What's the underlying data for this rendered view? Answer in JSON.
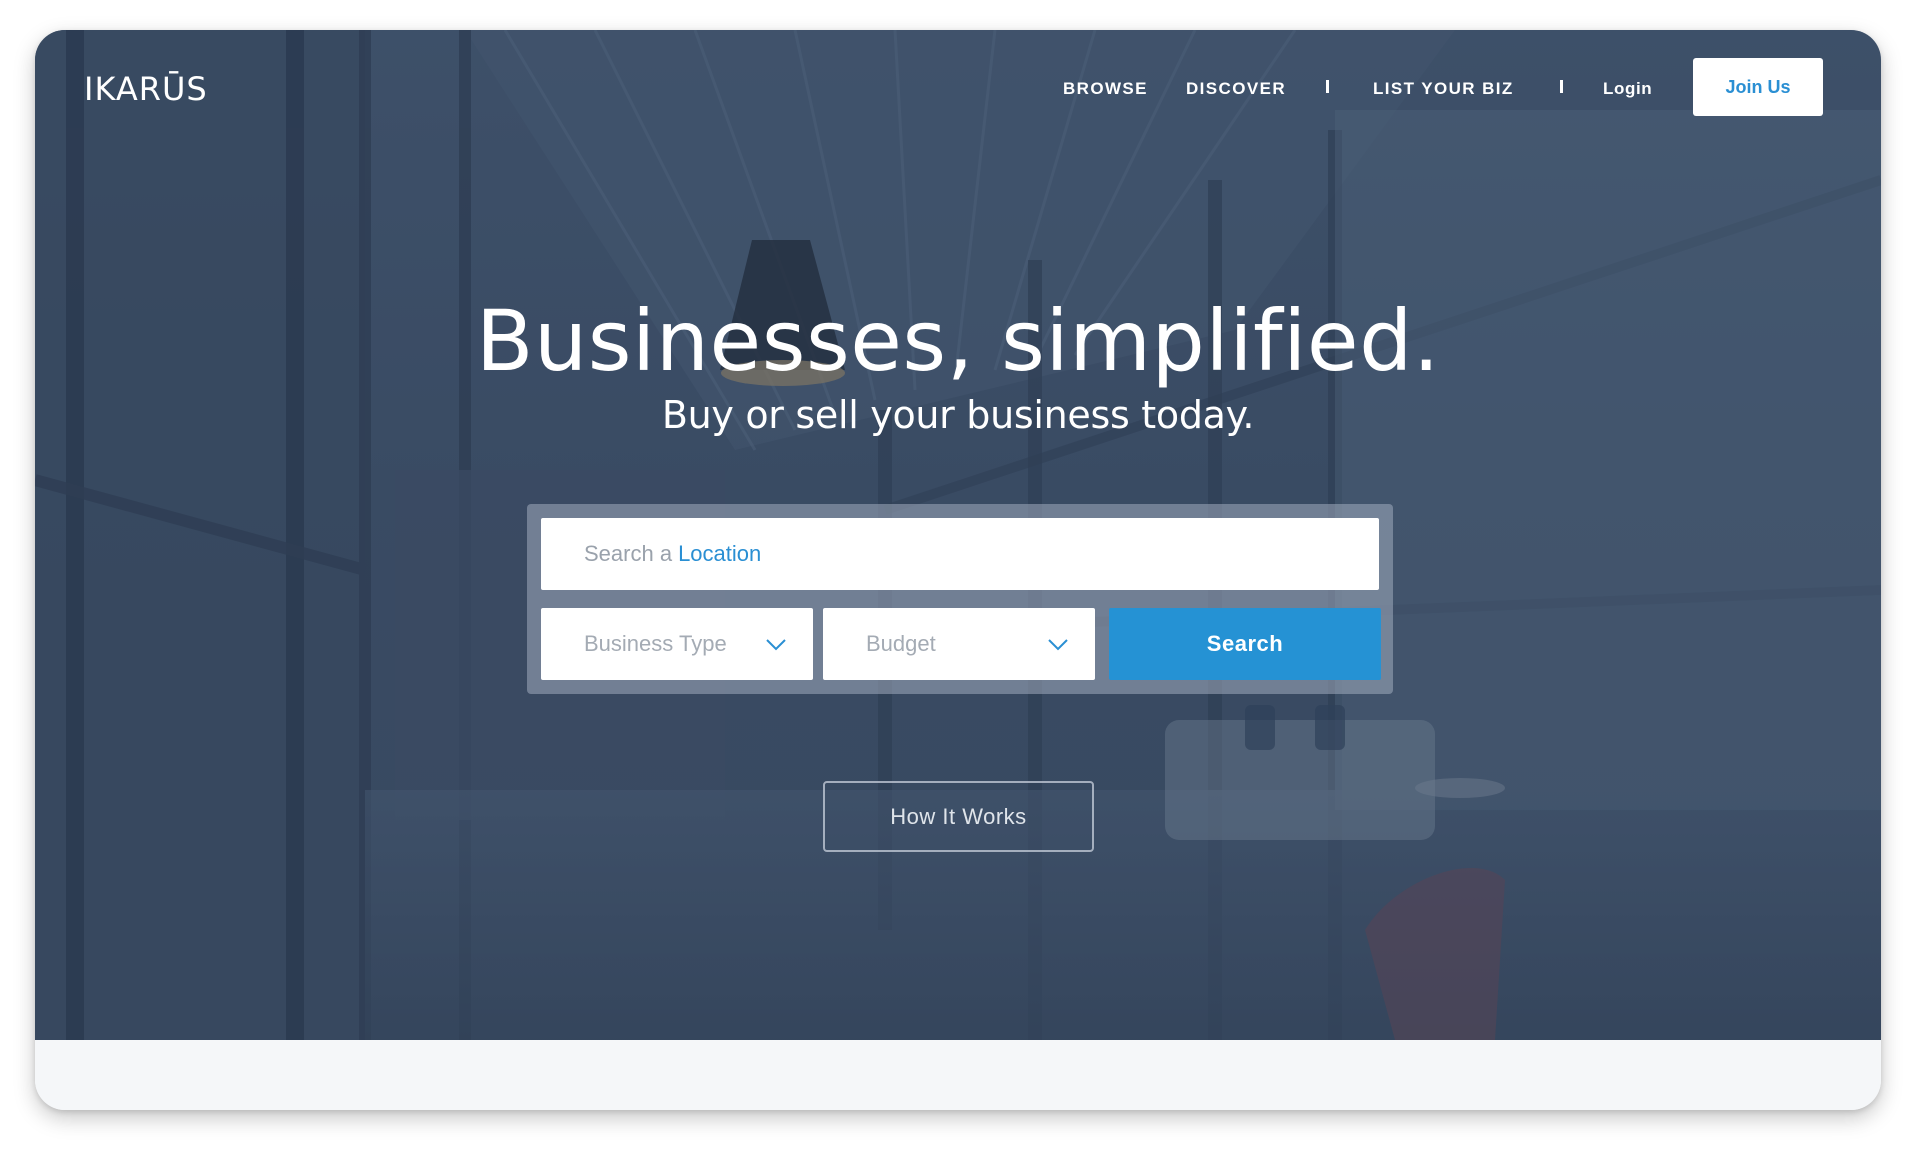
{
  "brand": {
    "logo": "IKARŪS"
  },
  "nav": {
    "items": [
      {
        "label": "BROWSE"
      },
      {
        "label": "DISCOVER"
      },
      {
        "label": "LIST YOUR BIZ"
      }
    ],
    "login_label": "Login",
    "join_label": "Join Us"
  },
  "hero": {
    "headline": "Businesses, simplified.",
    "subheadline": "Buy or sell your business today."
  },
  "search": {
    "location_placeholder_prefix": "Search a",
    "location_placeholder_accent": "Location",
    "business_type_placeholder": "Business Type",
    "budget_placeholder": "Budget",
    "search_label": "Search"
  },
  "how_it_works_label": "How It Works",
  "colors": {
    "accent": "#2592d4",
    "hero_overlay": "#3d4f68",
    "link_accent": "#2a8fd3"
  },
  "icons": {
    "dropdown": "chevron-down-icon"
  }
}
